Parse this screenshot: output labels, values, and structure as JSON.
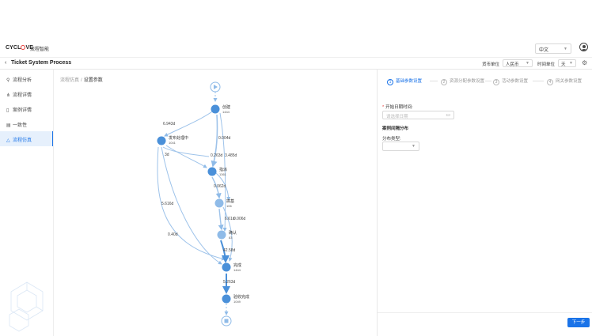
{
  "brand": {
    "logo": "CYCLOVE",
    "product": "流程智能"
  },
  "header": {
    "language": "中文"
  },
  "title_bar": {
    "back_icon": "chevron-left",
    "title": "Ticket System Process",
    "currency_label": "货币单位",
    "currency_value": "人民币",
    "time_unit_label": "时间单位",
    "time_unit_value": "天"
  },
  "sidebar": {
    "items": [
      {
        "label": "流程分析",
        "icon": "pin-icon"
      },
      {
        "label": "流程详情",
        "icon": "branch-icon"
      },
      {
        "label": "案例详情",
        "icon": "document-icon"
      },
      {
        "label": "一致性",
        "icon": "list-icon"
      },
      {
        "label": "流程仿真",
        "icon": "simulation-icon",
        "active": true
      }
    ]
  },
  "breadcrumb": {
    "root": "流程仿真",
    "separator": "/",
    "current": "设置参数"
  },
  "flow": {
    "nodes": [
      {
        "id": "start",
        "label": "",
        "count": ""
      },
      {
        "id": "n1",
        "label": "创建",
        "count": "1444"
      },
      {
        "id": "n2",
        "label": "发布处理中",
        "count": "1041"
      },
      {
        "id": "n3",
        "label": "指派",
        "count": "1361"
      },
      {
        "id": "n4",
        "label": "搞基",
        "count": "106"
      },
      {
        "id": "n5",
        "label": "确认",
        "count": "83"
      },
      {
        "id": "n6",
        "label": "完成",
        "count": "1444"
      },
      {
        "id": "n7",
        "label": "验收完成",
        "count": "1049"
      },
      {
        "id": "end",
        "label": "",
        "count": ""
      }
    ],
    "edge_labels": [
      "6.943d",
      "0.004d",
      "0.263d",
      "3.485d",
      "3d",
      "0.062d",
      "6.61d",
      "0.006d",
      "5.616d",
      "0.40d",
      "42.58d",
      "5.263d"
    ]
  },
  "panel": {
    "steps": [
      "基础参数设置",
      "资源分配参数设置",
      "活动参数设置",
      "网关参数设置"
    ],
    "step_numbers": [
      "1",
      "2",
      "3",
      "4"
    ],
    "start_date_label": "开始日期时间:",
    "start_date_placeholder": "请选择日期",
    "section_title": "案例间隔分布",
    "dist_label": "分布类型:",
    "next_button": "下一步"
  },
  "colors": {
    "accent": "#1a73e8",
    "node": "#4a90d9",
    "node_light": "#8fbbe8",
    "edge": "#9ec3ea"
  }
}
